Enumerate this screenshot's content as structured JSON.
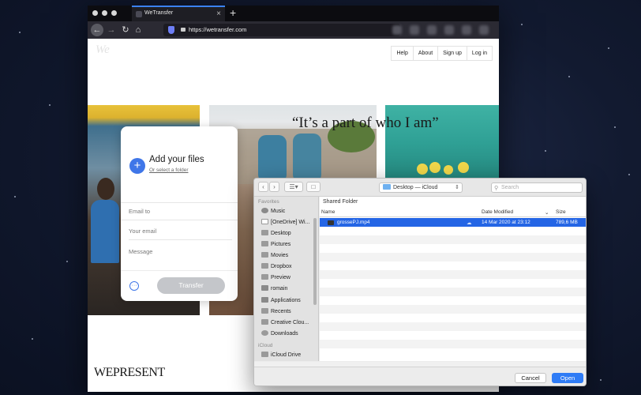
{
  "browser": {
    "tab_title": "WeTransfer",
    "tab_close": "×",
    "new_tab": "+",
    "url": "https://wetransfer.com"
  },
  "page": {
    "logo": "We",
    "nav": [
      "Help",
      "About",
      "Sign up",
      "Log in"
    ],
    "quote": "“It’s a part of who I am”",
    "footer_brand": "WEPRESENT"
  },
  "panel": {
    "add_title": "Add your files",
    "add_subtitle": "Or select a folder",
    "email_to": "Email to",
    "your_email": "Your email",
    "message": "Message",
    "transfer_button": "Transfer",
    "more_options": "···"
  },
  "dialog": {
    "location": "Desktop — iCloud",
    "search_placeholder": "Search",
    "section_title": "Shared Folder",
    "columns": {
      "name": "Name",
      "date": "Date Modified",
      "size": "Size"
    },
    "favorites_heading": "Favorites",
    "favorites": [
      "Music",
      "[OneDrive] Wi...",
      "Desktop",
      "Pictures",
      "Movies",
      "Dropbox",
      "Preview",
      "romain",
      "Applications",
      "Recents",
      "Creative Clou...",
      "Downloads"
    ],
    "icloud_heading": "iCloud",
    "icloud": [
      "iCloud Drive"
    ],
    "selected_file": {
      "name": "grossePJ.mp4",
      "date": "14 Mar 2020 at 23:12",
      "size": "789,6 MB"
    },
    "cancel_button": "Cancel",
    "open_button": "Open",
    "selection_color": "#2465e5"
  }
}
